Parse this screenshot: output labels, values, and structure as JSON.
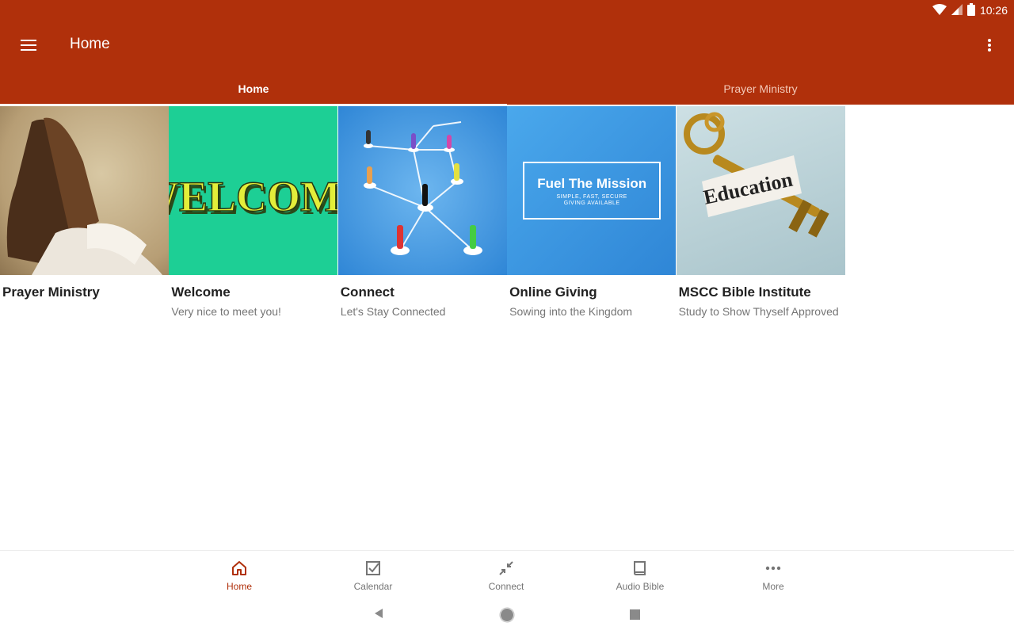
{
  "status": {
    "time": "10:26"
  },
  "toolbar": {
    "title": "Home"
  },
  "tabs": [
    {
      "label": "Home",
      "active": true
    },
    {
      "label": "Prayer Ministry",
      "active": false
    }
  ],
  "cards": [
    {
      "title": "Prayer Ministry",
      "subtitle": ""
    },
    {
      "title": "Welcome",
      "subtitle": "Very nice to meet you!",
      "image_text": "WELCOME"
    },
    {
      "title": "Connect",
      "subtitle": "Let's Stay Connected"
    },
    {
      "title": "Online Giving",
      "subtitle": "Sowing into the Kingdom",
      "image_title": "Fuel The Mission",
      "image_sub1": "SIMPLE, FAST, SECURE",
      "image_sub2": "GIVING AVAILABLE"
    },
    {
      "title": "MSCC Bible Institute",
      "subtitle": "Study to Show Thyself Approved",
      "image_text": "Education"
    }
  ],
  "bottom_nav": [
    {
      "label": "Home",
      "icon": "home-icon",
      "active": true
    },
    {
      "label": "Calendar",
      "icon": "calendar-check-icon",
      "active": false
    },
    {
      "label": "Connect",
      "icon": "connect-arrows-icon",
      "active": false
    },
    {
      "label": "Audio Bible",
      "icon": "book-icon",
      "active": false
    },
    {
      "label": "More",
      "icon": "more-dots-icon",
      "active": false
    }
  ],
  "colors": {
    "primary": "#b0300b",
    "accent_active": "#b0300b",
    "inactive": "#757575"
  }
}
